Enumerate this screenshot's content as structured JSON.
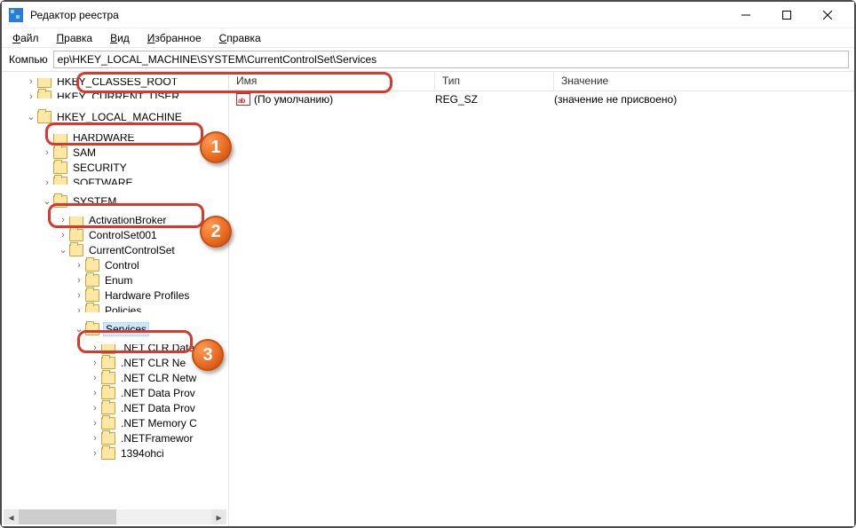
{
  "window": {
    "title": "Редактор реестра"
  },
  "menu": {
    "file": "Файл",
    "edit": "Правка",
    "view": "Вид",
    "favorites": "Избранное",
    "help": "Справка"
  },
  "addressbar": {
    "label": "Компью",
    "path": "ер\\HKEY_LOCAL_MACHINE\\SYSTEM\\CurrentControlSet\\Services"
  },
  "tree": {
    "n0": "HKEY_CLASSES_ROOT",
    "n1": "HKEY_CURRENT_USER",
    "n2": "HKEY_LOCAL_MACHINE",
    "n3": "HARDWARE",
    "n4": "SAM",
    "n5": "SECURITY",
    "n6": "SOFTWARE",
    "n7": "SYSTEM",
    "n8": "ActivationBroker",
    "n9": "ControlSet001",
    "n10": "CurrentControlSet",
    "n11": "Control",
    "n12": "Enum",
    "n13": "Hardware Profiles",
    "n14": "Policies",
    "n15": "Services",
    "n16": ".NET CLR Data",
    "n17": ".NET CLR Ne",
    "n18": ".NET CLR Netw",
    "n19": ".NET Data Prov",
    "n20": ".NET Data Prov",
    "n21": ".NET Memory C",
    "n22": ".NETFramewor",
    "n23": "1394ohci"
  },
  "columns": {
    "name": "Имя",
    "type": "Тип",
    "value": "Значение"
  },
  "row": {
    "name": "(По умолчанию)",
    "type": "REG_SZ",
    "value": "(значение не присвоено)"
  },
  "badges": {
    "b1": "1",
    "b2": "2",
    "b3": "3"
  }
}
